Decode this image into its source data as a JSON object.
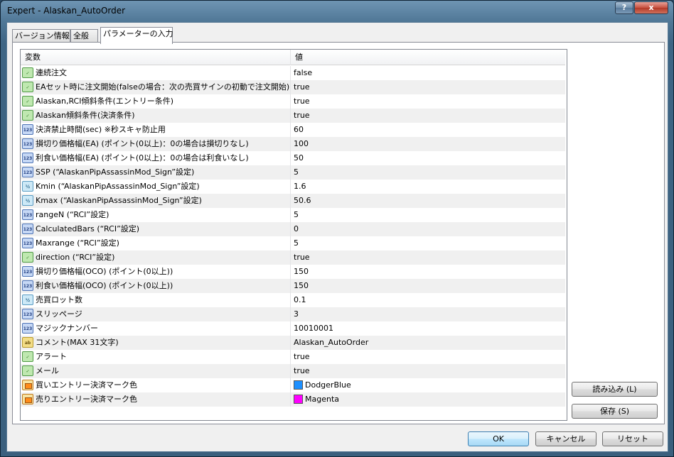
{
  "window": {
    "title": "Expert - Alaskan_AutoOrder",
    "help_label": "?",
    "close_label": "x"
  },
  "tabs": [
    "バージョン情報",
    "全般",
    "パラメーターの入力"
  ],
  "table": {
    "headers": [
      "変数",
      "値"
    ],
    "rows": [
      {
        "icon": "bool-icon",
        "name": "連続注文",
        "value": "false"
      },
      {
        "icon": "bool-icon",
        "name": "EAセット時に注文開始(falseの場合：次の売買サインの初動で注文開始)",
        "value": "true"
      },
      {
        "icon": "bool-icon",
        "name": "Alaskan,RCI傾斜条件(エントリー条件)",
        "value": "true"
      },
      {
        "icon": "bool-icon",
        "name": "Alaskan傾斜条件(決済条件)",
        "value": "true"
      },
      {
        "icon": "int-icon",
        "name": "決済禁止時間(sec) ※秒スキャ防止用",
        "value": "60"
      },
      {
        "icon": "int-icon",
        "name": "損切り価格幅(EA) (ポイント(0以上)：0の場合は損切りなし)",
        "value": "100"
      },
      {
        "icon": "int-icon",
        "name": "利食い価格幅(EA) (ポイント(0以上)：0の場合は利食いなし)",
        "value": "50"
      },
      {
        "icon": "int-icon",
        "name": "SSP (“AlaskanPipAssassinMod_Sign”設定)",
        "value": "5"
      },
      {
        "icon": "double-icon",
        "name": "Kmin (“AlaskanPipAssassinMod_Sign”設定)",
        "value": "1.6"
      },
      {
        "icon": "double-icon",
        "name": "Kmax (“AlaskanPipAssassinMod_Sign”設定)",
        "value": "50.6"
      },
      {
        "icon": "int-icon",
        "name": "rangeN (“RCI”設定)",
        "value": "5"
      },
      {
        "icon": "int-icon",
        "name": "CalculatedBars (“RCI”設定)",
        "value": "0"
      },
      {
        "icon": "int-icon",
        "name": "Maxrange (“RCI”設定)",
        "value": "5"
      },
      {
        "icon": "bool-icon",
        "name": "direction (“RCI”設定)",
        "value": "true"
      },
      {
        "icon": "int-icon",
        "name": "損切り価格幅(OCO) (ポイント(0以上))",
        "value": "150"
      },
      {
        "icon": "int-icon",
        "name": "利食い価格幅(OCO) (ポイント(0以上))",
        "value": "150"
      },
      {
        "icon": "double-icon",
        "name": "売買ロット数",
        "value": "0.1"
      },
      {
        "icon": "int-icon",
        "name": "スリッページ",
        "value": "3"
      },
      {
        "icon": "int-icon",
        "name": "マジックナンバー",
        "value": "10010001"
      },
      {
        "icon": "string-icon",
        "name": "コメント(MAX 31文字)",
        "value": "Alaskan_AutoOrder"
      },
      {
        "icon": "bool-icon",
        "name": "アラート",
        "value": "true"
      },
      {
        "icon": "bool-icon",
        "name": "メール",
        "value": "true"
      },
      {
        "icon": "color-icon",
        "name": "買いエントリー決済マーク色",
        "value": "DodgerBlue",
        "swatch": "#1e90ff"
      },
      {
        "icon": "color-icon",
        "name": "売りエントリー決済マーク色",
        "value": "Magenta",
        "swatch": "#ff00ff"
      }
    ]
  },
  "buttons": {
    "load": "読み込み (L)",
    "save": "保存 (S)",
    "ok": "OK",
    "cancel": "キャンセル",
    "reset": "リセット"
  }
}
